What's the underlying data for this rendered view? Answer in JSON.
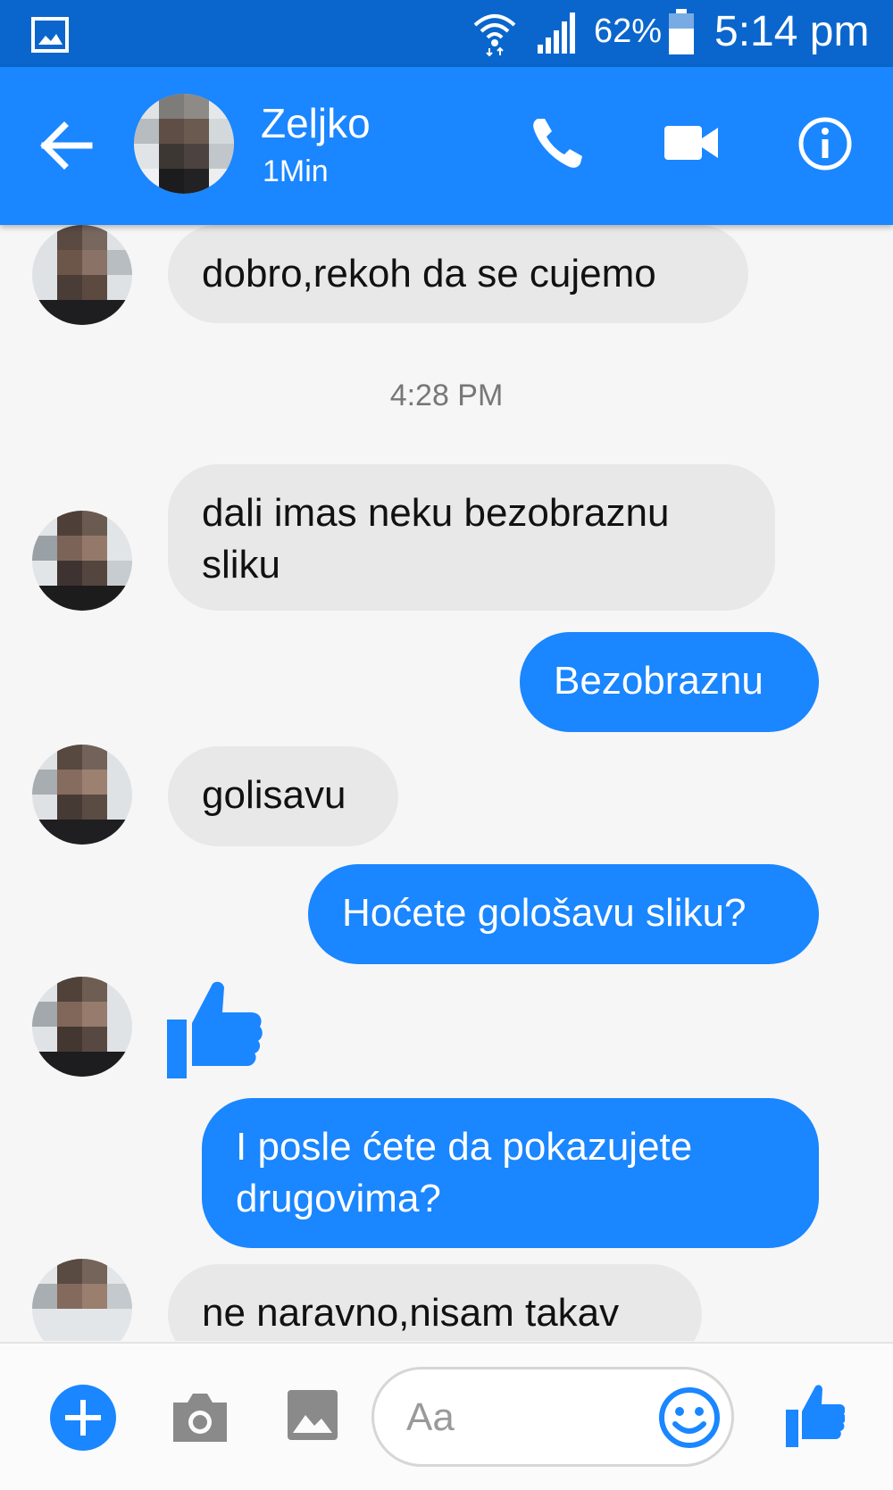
{
  "status_bar": {
    "battery_percent": "62%",
    "clock": "5:14 pm"
  },
  "header": {
    "contact_name": "Zeljko",
    "active_status": "1Min"
  },
  "conversation": {
    "timestamp": "4:28 PM",
    "messages": [
      {
        "from": "contact",
        "text": "dobro,rekoh da se cujemo"
      },
      {
        "from": "contact",
        "text": "dali imas neku bezobraznu sliku"
      },
      {
        "from": "me",
        "text": "Bezobraznu"
      },
      {
        "from": "contact",
        "text": "golisavu"
      },
      {
        "from": "me",
        "text": "Hoćete gološavu sliku?"
      },
      {
        "from": "contact",
        "text": ""
      },
      {
        "from": "me",
        "text": "I posle ćete da pokazujete drugovima?"
      },
      {
        "from": "contact",
        "text": "ne naravno,nisam takav"
      }
    ]
  },
  "composer": {
    "placeholder": "Aa"
  },
  "colors": {
    "status_bar": "#0a66cc",
    "header": "#1a86ff",
    "outgoing_bubble": "#1a86ff",
    "incoming_bubble": "#e8e8e8"
  }
}
